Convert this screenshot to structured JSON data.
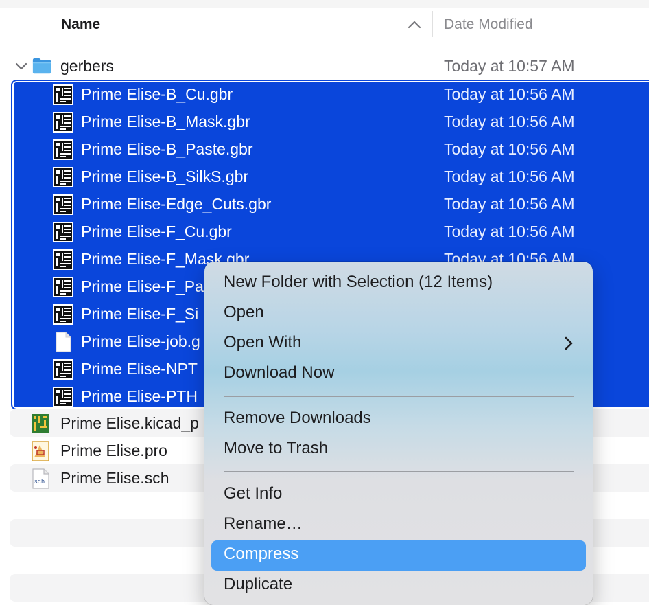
{
  "header": {
    "name_label": "Name",
    "date_label": "Date Modified"
  },
  "folder": {
    "name": "gerbers",
    "date": "Today at 10:57 AM"
  },
  "selected_files": [
    {
      "name": "Prime Elise-B_Cu.gbr",
      "date": "Today at 10:56 AM",
      "icon": "gerber-file-icon"
    },
    {
      "name": "Prime Elise-B_Mask.gbr",
      "date": "Today at 10:56 AM",
      "icon": "gerber-file-icon"
    },
    {
      "name": "Prime Elise-B_Paste.gbr",
      "date": "Today at 10:56 AM",
      "icon": "gerber-file-icon"
    },
    {
      "name": "Prime Elise-B_SilkS.gbr",
      "date": "Today at 10:56 AM",
      "icon": "gerber-file-icon"
    },
    {
      "name": "Prime Elise-Edge_Cuts.gbr",
      "date": "Today at 10:56 AM",
      "icon": "gerber-file-icon"
    },
    {
      "name": "Prime Elise-F_Cu.gbr",
      "date": "Today at 10:56 AM",
      "icon": "gerber-file-icon"
    },
    {
      "name": "Prime Elise-F_Mask.gbr",
      "date": "Today at 10:56 AM",
      "icon": "gerber-file-icon"
    },
    {
      "name": "Prime Elise-F_Pa",
      "date": "",
      "icon": "gerber-file-icon"
    },
    {
      "name": "Prime Elise-F_Si",
      "date": "",
      "icon": "gerber-file-icon"
    },
    {
      "name": "Prime Elise-job.g",
      "date": "",
      "icon": "document-icon"
    },
    {
      "name": "Prime Elise-NPT",
      "date": "",
      "icon": "gerber-file-icon"
    },
    {
      "name": "Prime Elise-PTH",
      "date": "",
      "icon": "gerber-file-icon"
    }
  ],
  "other_files": [
    {
      "name": "Prime Elise.kicad_p",
      "icon": "kicad-pcb-icon"
    },
    {
      "name": "Prime Elise.pro",
      "icon": "kicad-project-icon"
    },
    {
      "name": "Prime Elise.sch",
      "icon": "sch-file-icon"
    }
  ],
  "context_menu": {
    "items": [
      {
        "label": "New Folder with Selection (12 Items)"
      },
      {
        "label": "Open"
      },
      {
        "label": "Open With",
        "submenu": true
      },
      {
        "label": "Download Now"
      },
      {
        "label": "Remove Downloads"
      },
      {
        "label": "Move to Trash"
      },
      {
        "label": "Get Info"
      },
      {
        "label": "Rename…"
      },
      {
        "label": "Compress",
        "highlighted": true
      },
      {
        "label": "Duplicate"
      }
    ]
  },
  "colors": {
    "selection": "#0a46db",
    "menu_highlight": "#4b9ff4",
    "folder": "#4aa3e8"
  }
}
